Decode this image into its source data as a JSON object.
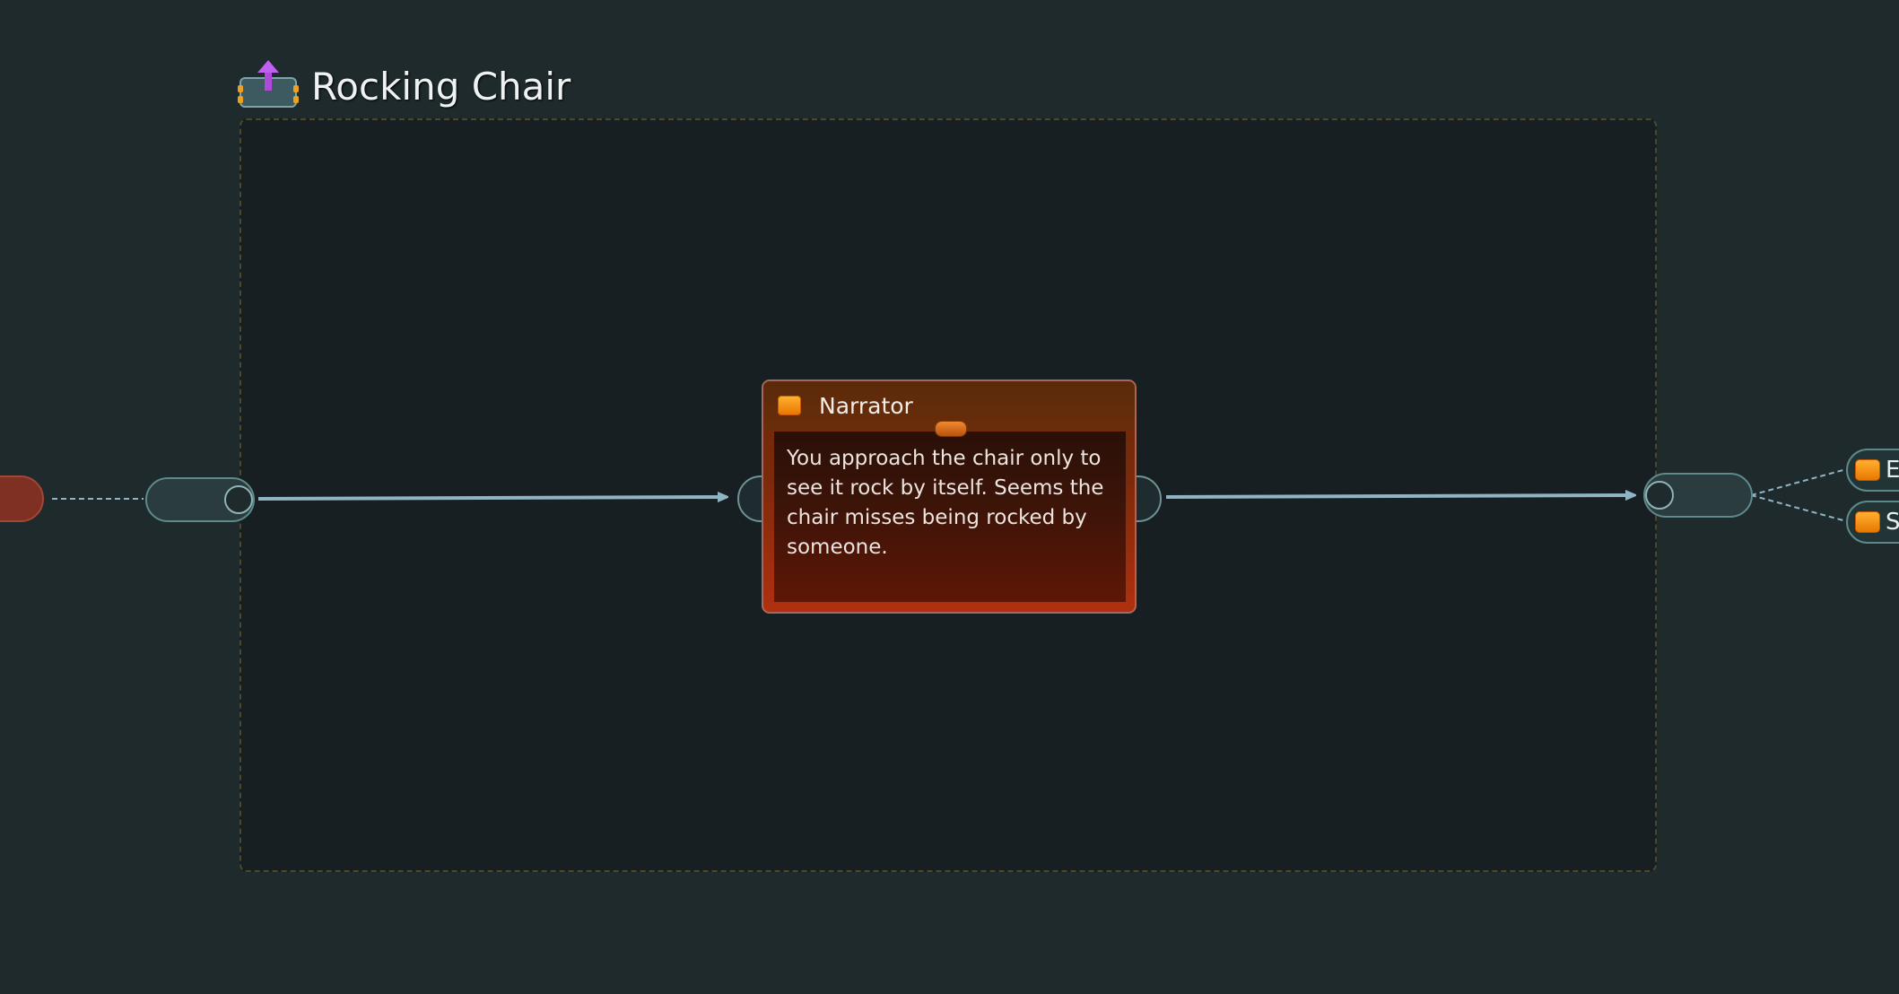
{
  "container": {
    "title": "Rocking Chair",
    "icon": "export-upload-icon"
  },
  "dialog": {
    "speaker": "Narrator",
    "text": "You approach the chair only to see it rock by itself. Seems the chair misses being rocked by someone.",
    "speaker_icon": "speaker-icon"
  },
  "right_entries": [
    {
      "label": "E",
      "icon": "speaker-icon"
    },
    {
      "label": "S",
      "icon": "speaker-icon"
    }
  ],
  "colors": {
    "background": "#1e2a2c",
    "container": "#171f22",
    "connector": "#8fb4c4",
    "dialog_accent": "#b0300f",
    "left_node": "#7e3022"
  }
}
